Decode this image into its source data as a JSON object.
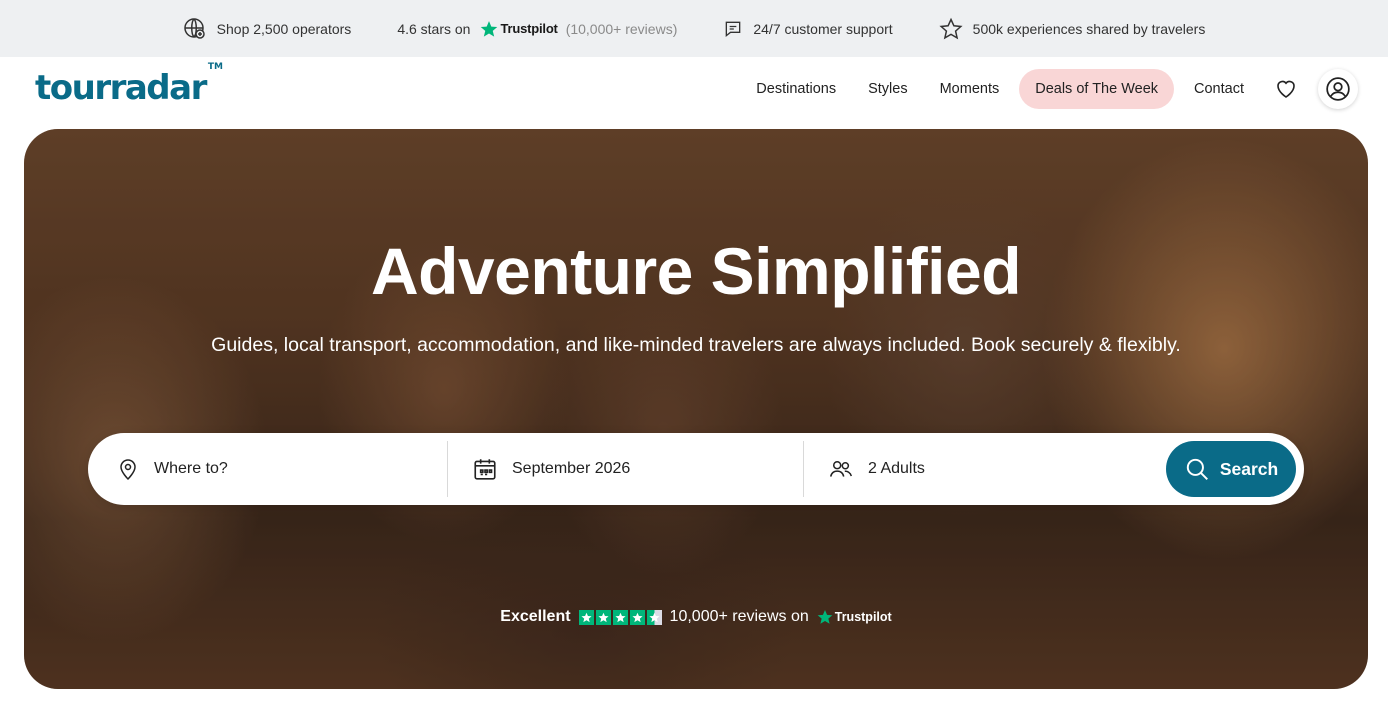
{
  "topbar": {
    "operators": "Shop 2,500 operators",
    "rating_prefix": "4.6 stars on",
    "trustpilot": "Trustpilot",
    "reviews": "(10,000+ reviews)",
    "support": "24/7 customer support",
    "experiences": "500k experiences shared by travelers"
  },
  "header": {
    "logo": "tourradar",
    "logo_tm": "TM",
    "nav": [
      "Destinations",
      "Styles",
      "Moments",
      "Deals of The Week",
      "Contact"
    ]
  },
  "hero": {
    "title": "Adventure Simplified",
    "subtitle": "Guides, local transport, accommodation, and like-minded travelers are always included. Book securely & flexibly."
  },
  "search": {
    "destination_placeholder": "Where to?",
    "date": "September 2026",
    "travelers": "2 Adults",
    "button": "Search"
  },
  "trust": {
    "rating_word": "Excellent",
    "stars": 4.5,
    "reviews": "10,000+ reviews on",
    "brand": "Trustpilot"
  },
  "colors": {
    "brand": "#0a6b88",
    "deal_bg": "#f9d6d6",
    "trustpilot_green": "#00b67a",
    "topbar_bg": "#eef0f2"
  },
  "icons": [
    "globe-operator-icon",
    "trustpilot-star-icon",
    "chat-icon",
    "star-outline-icon",
    "heart-icon",
    "user-icon",
    "location-pin-icon",
    "calendar-icon",
    "people-icon",
    "search-icon"
  ]
}
